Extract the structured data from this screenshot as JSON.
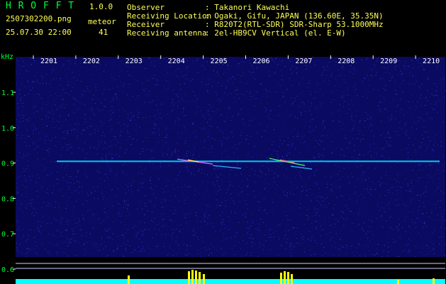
{
  "header": {
    "app_title": "H R O F F T",
    "version": "1.0.0",
    "filename": "2507302200.png",
    "meteor_label": "meteor",
    "datetime": "25.07.30 22:00",
    "meteor_count": "41",
    "info": [
      {
        "label": "Observer",
        "value": ": Takanori Kawachi"
      },
      {
        "label": "Receiving Location",
        "value": ": Ogaki, Gifu, JAPAN (136.60E, 35.35N)"
      },
      {
        "label": "Receiver",
        "value": ": R820T2(RTL-SDR) SDR-Sharp 53.1000MHz"
      },
      {
        "label": "Receiving antenna",
        "value": ": 2el-HB9CV Vertical (el. E-W)"
      }
    ]
  },
  "spectrogram": {
    "unit": "kHz",
    "time_labels": [
      "2201",
      "2202",
      "2203",
      "2204",
      "2205",
      "2206",
      "2207",
      "2208",
      "2209",
      "2210"
    ],
    "freq_labels": [
      "1.1",
      "1.0",
      "0.9",
      "0.8",
      "0.7",
      "0.6"
    ],
    "freq_values": [
      1.1,
      1.0,
      0.9,
      0.8,
      0.7,
      0.6
    ],
    "carrier_khz": 0.905,
    "minutes_range": [
      2201,
      2210
    ]
  },
  "colors": {
    "background": "#000000",
    "noise_floor": "#0a0a60",
    "text_green": "#00ff3a",
    "text_yellow": "#ffff55",
    "trace": "#00ffff",
    "activity": "#ffff00"
  }
}
